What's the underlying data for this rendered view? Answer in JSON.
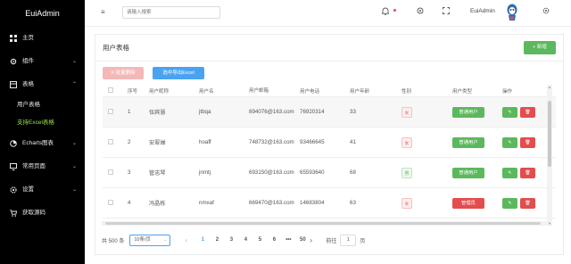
{
  "app": {
    "title": "EuiAdmin"
  },
  "sidebar": {
    "items": [
      {
        "label": "主页",
        "icon": "grid-icon"
      },
      {
        "label": "组件",
        "icon": "gear-icon",
        "expandable": true
      },
      {
        "label": "表格",
        "icon": "table-icon",
        "expandable": true,
        "expanded": true,
        "children": [
          {
            "label": "用户表格",
            "active": false
          },
          {
            "label": "支持Excel表格",
            "active": true
          }
        ]
      },
      {
        "label": "Echarts图表",
        "icon": "chart-icon",
        "expandable": true
      },
      {
        "label": "常用页面",
        "icon": "monitor-icon",
        "expandable": true
      },
      {
        "label": "设置",
        "icon": "settings-icon",
        "expandable": true
      },
      {
        "label": "获取源码",
        "icon": "cart-icon"
      }
    ]
  },
  "header": {
    "search_placeholder": "请输入搜索",
    "user_name": "EuiAdmin",
    "icons": [
      "menu-icon",
      "bell-icon",
      "status-dot-icon",
      "fullscreen-icon",
      "avatar",
      "gear-icon"
    ]
  },
  "card": {
    "title": "用户表格",
    "new_button": "+ 新增",
    "batch_delete_button": "X 批量删除",
    "export_button": "选中导出Excel"
  },
  "table": {
    "headers": [
      "序号",
      "用户昵称",
      "用户名",
      "用户邮箱",
      "用户电话",
      "用户年龄",
      "性别",
      "用户类型",
      "操作"
    ],
    "rows": [
      {
        "index": "1",
        "nickname": "伍宾慧",
        "username": "jtbqa",
        "email": "894076@163.com",
        "phone": "76920314",
        "age": "33",
        "sex": "女",
        "sex_type": "female",
        "type": "普通用户",
        "type_kind": "normal"
      },
      {
        "index": "2",
        "nickname": "安翠婵",
        "username": "hoaff",
        "email": "748732@163.com",
        "phone": "93466645",
        "age": "41",
        "sex": "女",
        "sex_type": "female",
        "type": "普通用户",
        "type_kind": "normal"
      },
      {
        "index": "3",
        "nickname": "管志琴",
        "username": "jnmtj",
        "email": "693150@163.com",
        "phone": "65593640",
        "age": "68",
        "sex": "男",
        "sex_type": "male",
        "type": "普通用户",
        "type_kind": "normal"
      },
      {
        "index": "4",
        "nickname": "冯晶栋",
        "username": "nmxaf",
        "email": "669470@163.com",
        "phone": "14683804",
        "age": "63",
        "sex": "女",
        "sex_type": "female",
        "type": "管理员",
        "type_kind": "admin"
      }
    ],
    "edit_label": "✎",
    "delete_label": "🗑"
  },
  "pagination": {
    "total": "共 500 条",
    "page_size": "10条/页",
    "pages": [
      "1",
      "2",
      "3",
      "4",
      "5",
      "6",
      "•••",
      "50"
    ],
    "current_page": "1",
    "goto_label": "前往",
    "goto_value": "1",
    "page_suffix": "页"
  },
  "colors": {
    "sidebar_bg": "#000000",
    "active_green": "#9be045",
    "success": "#5cb85c",
    "danger": "#e34d4d",
    "primary": "#4aa3f0"
  }
}
